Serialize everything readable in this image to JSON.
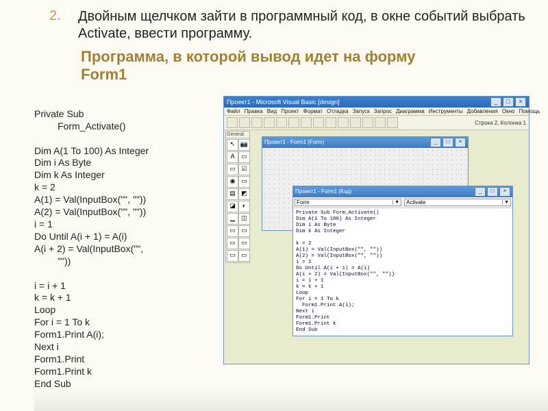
{
  "list_number": "2.",
  "task_text": "Двойным щелчком зайти в программный код, в окне событий выбрать Activate, ввести программу.",
  "program_title_line1": "Программа, в которой вывод идет на форму",
  "program_title_line2": "Form1",
  "code_listing": {
    "l1": "Private Sub",
    "l1b": "Form_Activate()",
    "l2": "Dim A(1 To 100) As Integer",
    "l3": "Dim i As Byte",
    "l4": "Dim k As Integer",
    "l5": "k = 2",
    "l6": "A(1) = Val(InputBox(\"\", \"\"))",
    "l7": "A(2) = Val(InputBox(\"\", \"\"))",
    "l8": "i = 1",
    "l9": "Do Until A(i + 1) = A(i)",
    "l10": "A(i + 2) = Val(InputBox(\"\",",
    "l10b": "\"\"))",
    "l11": "i = i + 1",
    "l12": "k = k + 1",
    "l13": "Loop",
    "l14": "For i = 1 To k",
    "l15": "Form1.Print A(i);",
    "l16": "Next i",
    "l17": "Form1.Print",
    "l18": "Form1.Print k",
    "l19": "End Sub"
  },
  "vb_app": {
    "title": "Проект1 - Microsoft Visual Basic [design]",
    "menu": [
      "Файл",
      "Правка",
      "Вид",
      "Проект",
      "Формат",
      "Отладка",
      "Запуск",
      "Запрос",
      "Диаграмма",
      "Инструменты",
      "Добавления",
      "Окно",
      "Помощь"
    ],
    "status": "Строка 2, Колонка 1",
    "palette_title": "General",
    "palette_glyphs": [
      "↖",
      "📷",
      "A",
      "▭",
      "▭",
      "☑",
      "◉",
      "▭",
      "▤",
      "◩",
      "◪",
      "◐",
      "▁",
      "◫",
      "▭",
      "▭",
      "▭",
      "▭",
      "▭",
      "▭"
    ],
    "form_window_title": "Проект1 - Form1 (Form)",
    "code_window_title": "Проект1 - Form1 (Код)",
    "dropdown_left": "Form",
    "dropdown_right": "Activate",
    "code_text": "Private Sub Form_Activate()\nDim A(1 To 100) As Integer\nDim i As Byte\nDim k As Integer\n\nk = 2\nA(1) = Val(InputBox(\"\", \"\"))\nA(2) = Val(InputBox(\"\", \"\"))\ni = 1\nDo Until A(i + 1) = A(i)\nA(i + 2) = Val(InputBox(\"\", \"\"))\ni = i + 1\nk = k + 1\nLoop\nFor i = 1 To k\n  Form1.Print A(i);\nNext i\nForm1.Print\nForm1.Print k\nEnd Sub"
  },
  "win_buttons": {
    "min": "_",
    "max": "□",
    "close": "×"
  }
}
